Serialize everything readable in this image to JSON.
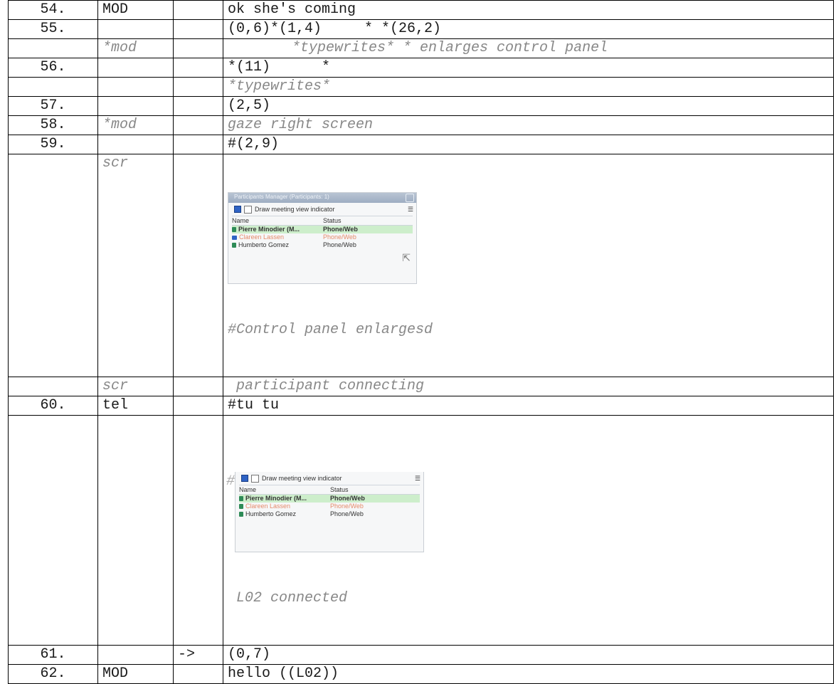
{
  "rows": [
    {
      "num": "54.",
      "speaker": "MOD",
      "arrow": "",
      "text": "ok she's coming"
    },
    {
      "num": "55.",
      "speaker": "",
      "arrow": "",
      "text": "(0,6)*(1,4)     * *(26,2)"
    },
    {
      "num": "",
      "speaker": "*mod",
      "arrow": "",
      "text": "*typewrites* * enlarges control panel"
    },
    {
      "num": "56.",
      "speaker": "",
      "arrow": "",
      "text": "*(11)      *"
    },
    {
      "num": "",
      "speaker": "",
      "arrow": "",
      "text": "*typewrites*"
    },
    {
      "num": "57.",
      "speaker": "",
      "arrow": "",
      "text": "(2,5)"
    },
    {
      "num": "58.",
      "speaker": "*mod",
      "arrow": "",
      "text": "gaze right screen"
    },
    {
      "num": "59.",
      "speaker": "",
      "arrow": "",
      "text": "#(2,9)"
    },
    {
      "num": "",
      "speaker": "scr",
      "arrow": "",
      "caption": "#Control panel enlargesd"
    },
    {
      "num": "",
      "speaker": "scr",
      "arrow": "",
      "text": " participant connecting"
    },
    {
      "num": "60.",
      "speaker": "tel",
      "arrow": "",
      "text": "#tu tu"
    },
    {
      "num": "",
      "speaker": "",
      "arrow": "",
      "hash": "#",
      "caption": " L02 connected"
    },
    {
      "num": "61.",
      "speaker": "",
      "arrow": "->",
      "text": "(0,7)"
    },
    {
      "num": "62.",
      "speaker": "MOD",
      "arrow": "",
      "text": "hello ((L02))"
    }
  ],
  "panel": {
    "title": "Participants Manager (Participants: 1)",
    "checkbox_label": "Draw meeting view indicator",
    "col_name": "Name",
    "col_status": "Status",
    "participants": [
      {
        "name": "Pierre Minodier (M...",
        "status": "Phone/Web"
      },
      {
        "name": "Clareen Lassen",
        "status": "Phone/Web"
      },
      {
        "name": "Humberto Gomez",
        "status": "Phone/Web"
      }
    ]
  }
}
